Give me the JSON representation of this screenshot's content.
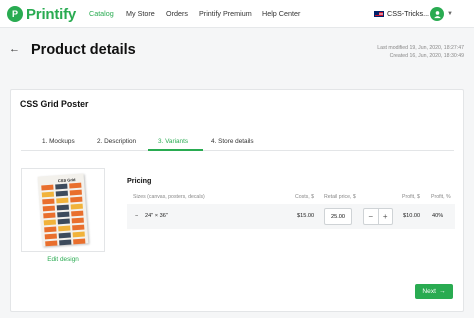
{
  "brand": {
    "name": "Printify",
    "accent": "#29ab51"
  },
  "nav": {
    "links": [
      {
        "label": "Catalog",
        "active": true
      },
      {
        "label": "My Store",
        "active": false
      },
      {
        "label": "Orders",
        "active": false
      },
      {
        "label": "Printify Premium",
        "active": false
      },
      {
        "label": "Help Center",
        "active": false
      }
    ],
    "store": {
      "label": "CSS-Tricks...",
      "icon": "uk-flag-icon"
    },
    "avatar_icon": "user-icon"
  },
  "header": {
    "back_icon": "arrow-left-icon",
    "title": "Product details",
    "last_modified": "Last modified 19, Jun, 2020, 18:27:47",
    "created": "Created 16, Jun, 2020, 18:30:49"
  },
  "product": {
    "name": "CSS Grid Poster",
    "tabs": [
      {
        "label": "1. Mockups",
        "active": false
      },
      {
        "label": "2. Description",
        "active": false
      },
      {
        "label": "3. Variants",
        "active": true
      },
      {
        "label": "4. Store details",
        "active": false
      }
    ],
    "mockup": {
      "poster_title": "CSS Grid",
      "edit_label": "Edit design"
    }
  },
  "pricing": {
    "title": "Pricing",
    "columns": {
      "size": "Sizes (canvas, posters, decals)",
      "cost": "Costs, $",
      "retail": "Retail price, $",
      "profit": "Profit, $",
      "profit_pct": "Profit, %"
    },
    "rows": [
      {
        "collapse": "−",
        "size": "24\" × 36\"",
        "cost": "$15.00",
        "retail": "25.00",
        "minus": "−",
        "plus": "+",
        "profit": "$10.00",
        "profit_pct": "40%"
      }
    ]
  },
  "footer": {
    "next_label": "Next",
    "next_icon": "arrow-right-icon"
  }
}
